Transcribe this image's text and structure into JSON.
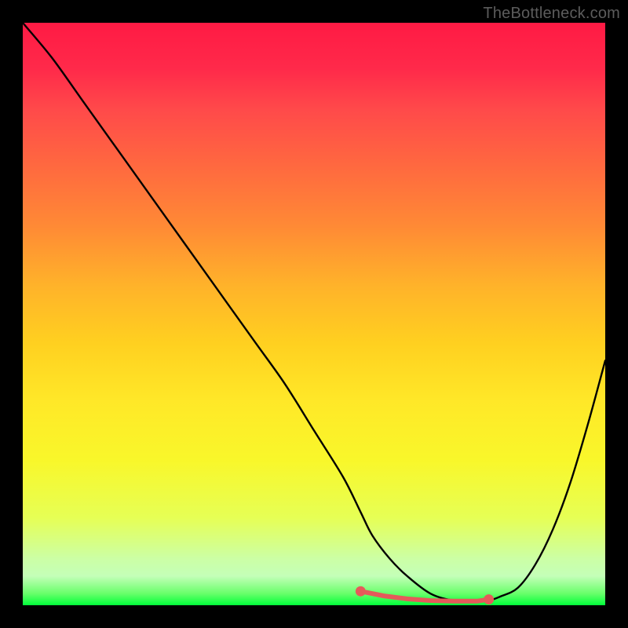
{
  "watermark": "TheBottleneck.com",
  "colors": {
    "page_bg": "#000000",
    "curve": "#000000",
    "marker_fill": "#e55a5a",
    "marker_stroke": "#c94b4b",
    "watermark_text": "#5c5c5c"
  },
  "chart_data": {
    "type": "line",
    "title": "",
    "xlabel": "",
    "ylabel": "",
    "xlim": [
      0,
      100
    ],
    "ylim": [
      0,
      100
    ],
    "grid": false,
    "curve": {
      "x": [
        0,
        5,
        10,
        15,
        20,
        25,
        30,
        35,
        40,
        45,
        50,
        55,
        58,
        60,
        63,
        66,
        70,
        74,
        78,
        80,
        82,
        85,
        88,
        91,
        94,
        97,
        100
      ],
      "y": [
        100,
        94,
        87,
        80,
        73,
        66,
        59,
        52,
        45,
        38,
        30,
        22,
        16,
        12,
        8,
        5,
        2,
        0.8,
        0.6,
        0.8,
        1.5,
        3,
        7,
        13,
        21,
        31,
        42
      ]
    },
    "markers": {
      "x": [
        58,
        62,
        66,
        70,
        74,
        78,
        80
      ],
      "y": [
        2.4,
        1.6,
        1.1,
        0.8,
        0.7,
        0.7,
        1.0
      ]
    },
    "background_gradient": "red-to-green vertical"
  }
}
